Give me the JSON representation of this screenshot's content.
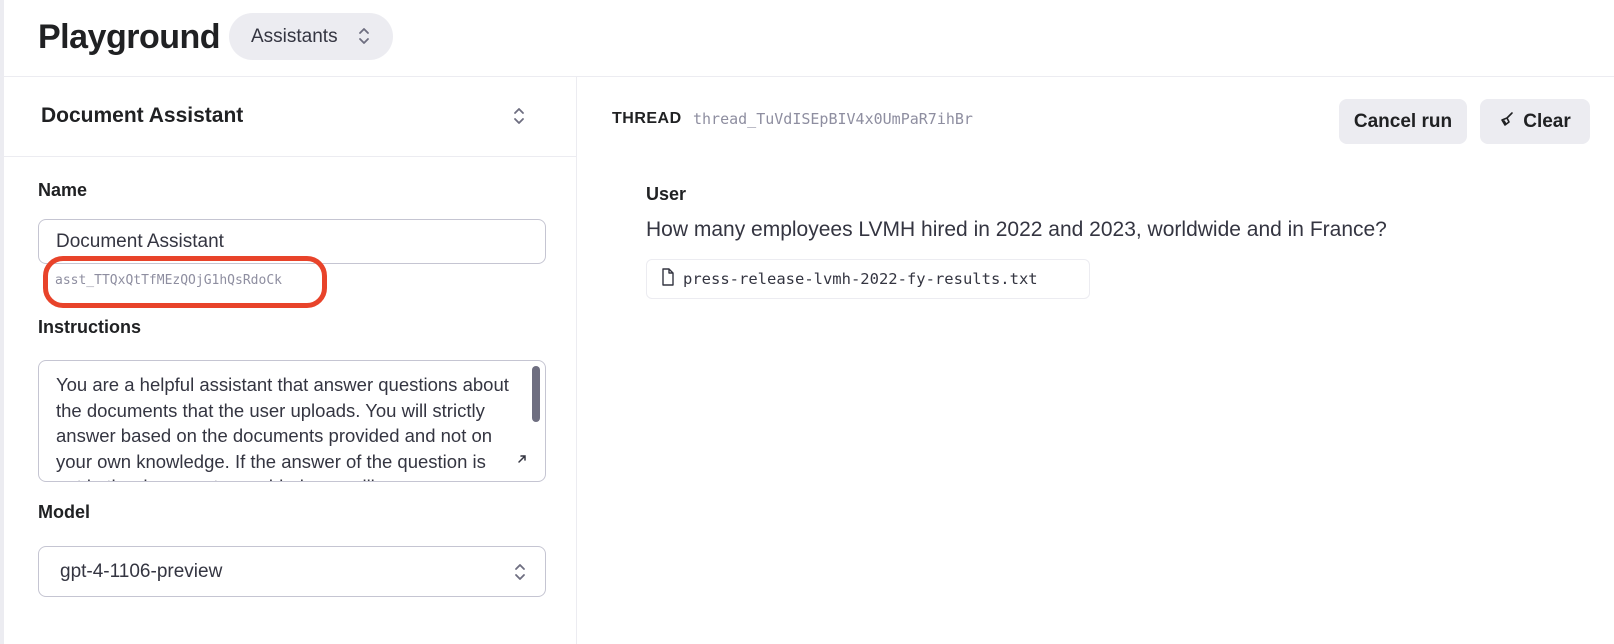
{
  "header": {
    "title": "Playground",
    "mode_selector": {
      "value": "Assistants"
    }
  },
  "assistant": {
    "selected_name": "Document Assistant",
    "name_label": "Name",
    "name_value": "Document Assistant",
    "id": "asst_TTQxQtTfMEzQOjG1hQsRdoCk",
    "instructions_label": "Instructions",
    "instructions": "You are a helpful assistant that answer questions about the documents that the user uploads. You will strictly answer based on the documents provided and not on your own knowledge. If the answer of the question is not in the documents provided, you will",
    "model_label": "Model",
    "model_value": "gpt-4-1106-preview"
  },
  "thread": {
    "label": "THREAD",
    "id": "thread_TuVdISEpBIV4x0UmPaR7ihBr",
    "cancel_button": "Cancel run",
    "clear_button": "Clear"
  },
  "messages": [
    {
      "role": "User",
      "text": "How many employees LVMH hired in 2022 and 2023, worldwide and in France?",
      "attachment": "press-release-lvmh-2022-fy-results.txt"
    }
  ],
  "colors": {
    "highlight": "#e8432a",
    "button_bg": "#ececf1",
    "border": "#c5c5d2",
    "muted_text": "#8e8ea0"
  },
  "icons": {
    "select_chevron": "chevron-up-down-icon",
    "clear": "broom-icon",
    "attachment": "file-icon",
    "resize": "expand-icon"
  }
}
